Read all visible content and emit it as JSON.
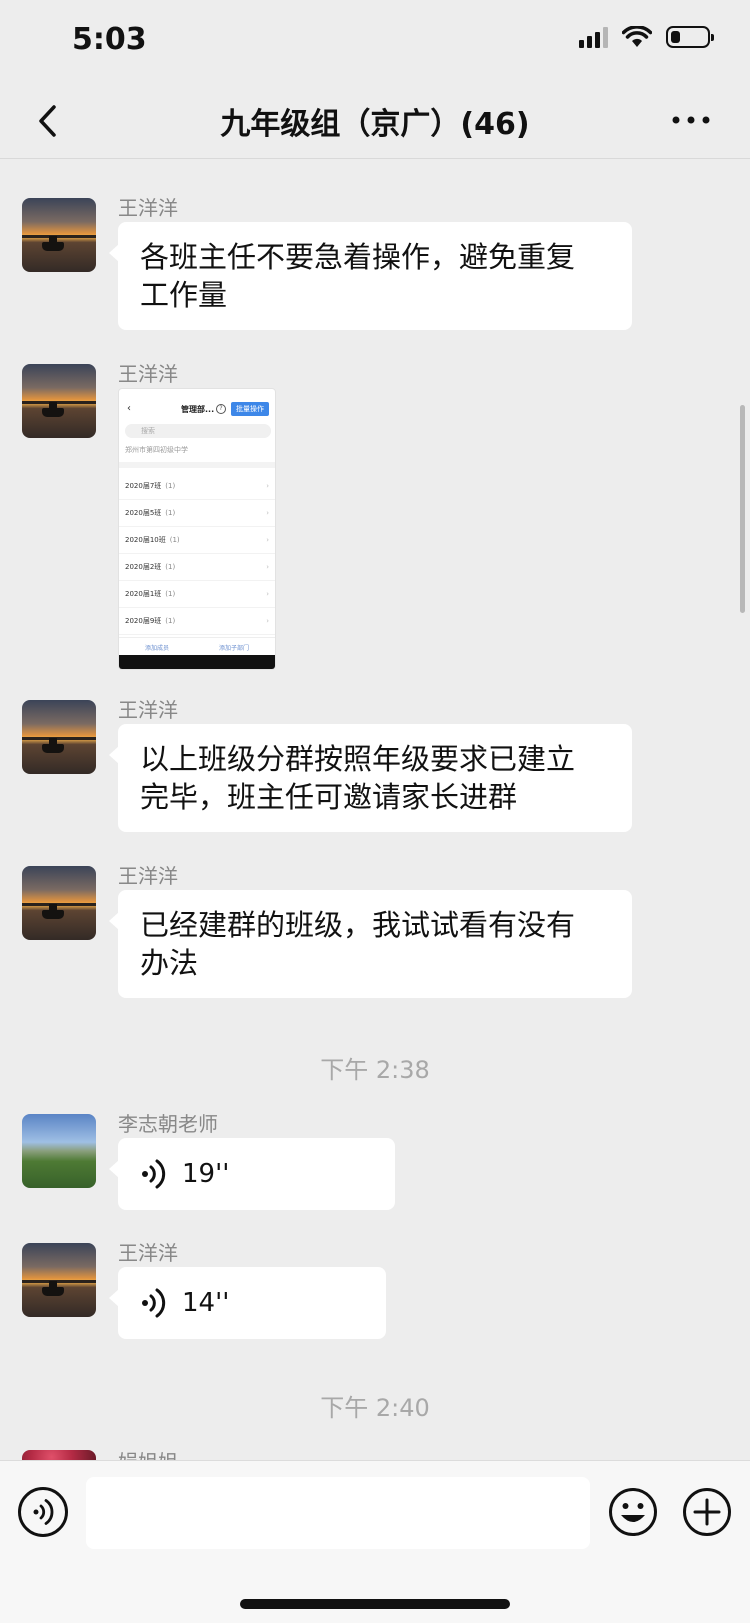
{
  "status_bar": {
    "time": "5:03"
  },
  "header": {
    "title": "九年级组（京广）(46)"
  },
  "messages": [
    {
      "sender": "王洋洋",
      "text_line1": "各班主任不要急着操作，避免重复",
      "text_line2": "工作量"
    },
    {
      "sender": "王洋洋",
      "image": {
        "title": "管理部...",
        "action": "批量操作",
        "search_placeholder": "搜索",
        "org": "郑州市第四初级中学",
        "rows": [
          {
            "name": "2020届7班",
            "count": "(1)"
          },
          {
            "name": "2020届5班",
            "count": "(1)"
          },
          {
            "name": "2020届10班",
            "count": "(1)"
          },
          {
            "name": "2020届2班",
            "count": "(1)"
          },
          {
            "name": "2020届1班",
            "count": "(1)"
          },
          {
            "name": "2020届9班",
            "count": "(1)"
          }
        ],
        "footer_left": "添加成员",
        "footer_right": "添加子部门"
      }
    },
    {
      "sender": "王洋洋",
      "text_line1": "以上班级分群按照年级要求已建立",
      "text_line2": "完毕，班主任可邀请家长进群"
    },
    {
      "sender": "王洋洋",
      "text_line1": "已经建群的班级，我试试看有没有",
      "text_line2": "办法"
    },
    {
      "sender": "李志朝老师",
      "voice_duration": "19''"
    },
    {
      "sender": "王洋洋",
      "voice_duration": "14''"
    },
    {
      "sender": "娟姐姐"
    }
  ],
  "timestamps": [
    "下午 2:38",
    "下午 2:40"
  ],
  "icons": {
    "back": "chevron-left-icon",
    "more": "more-icon",
    "voice": "voice-wave-icon",
    "emoji": "emoji-icon",
    "plus": "plus-icon"
  }
}
